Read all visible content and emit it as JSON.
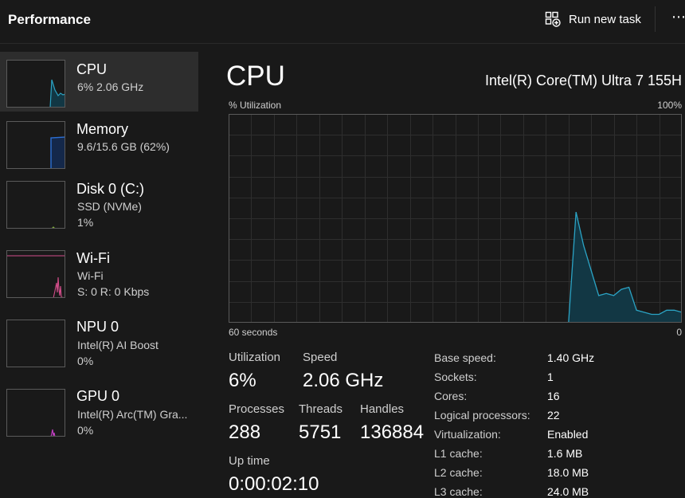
{
  "header": {
    "title": "Performance",
    "run_new_task": "Run new task",
    "more": "⋯"
  },
  "sidebar": {
    "items": [
      {
        "name": "CPU",
        "line1": "6%  2.06 GHz",
        "line2": ""
      },
      {
        "name": "Memory",
        "line1": "9.6/15.6 GB (62%)",
        "line2": ""
      },
      {
        "name": "Disk 0 (C:)",
        "line1": "SSD (NVMe)",
        "line2": "1%"
      },
      {
        "name": "Wi-Fi",
        "line1": "Wi-Fi",
        "line2": "S: 0  R: 0 Kbps"
      },
      {
        "name": "NPU 0",
        "line1": "Intel(R) AI Boost",
        "line2": "0%"
      },
      {
        "name": "GPU 0",
        "line1": "Intel(R) Arc(TM) Gra...",
        "line2": "0%"
      }
    ]
  },
  "main": {
    "title": "CPU",
    "model": "Intel(R) Core(TM) Ultra 7 155H",
    "graph": {
      "y_label": "% Utilization",
      "y_max_label": "100%",
      "x_left_label": "60 seconds",
      "x_right_label": "0"
    },
    "stats": {
      "utilization_label": "Utilization",
      "utilization": "6%",
      "speed_label": "Speed",
      "speed": "2.06 GHz",
      "processes_label": "Processes",
      "processes": "288",
      "threads_label": "Threads",
      "threads": "5751",
      "handles_label": "Handles",
      "handles": "136884",
      "uptime_label": "Up time",
      "uptime": "0:00:02:10"
    },
    "specs": [
      {
        "label": "Base speed:",
        "value": "1.40 GHz"
      },
      {
        "label": "Sockets:",
        "value": "1"
      },
      {
        "label": "Cores:",
        "value": "16"
      },
      {
        "label": "Logical processors:",
        "value": "22"
      },
      {
        "label": "Virtualization:",
        "value": "Enabled"
      },
      {
        "label": "L1 cache:",
        "value": "1.6 MB"
      },
      {
        "label": "L2 cache:",
        "value": "18.0 MB"
      },
      {
        "label": "L3 cache:",
        "value": "24.0 MB"
      }
    ]
  },
  "colors": {
    "cpu_line": "#2ba3c4",
    "cpu_fill": "#123744",
    "memory_line": "#2c6fd4",
    "wifi_line": "#d24d8a",
    "gpu_line": "#c43fc4",
    "disk_line": "#7fae3a"
  },
  "chart_data": {
    "type": "area",
    "x": [
      60,
      59,
      58,
      57,
      56,
      55,
      54,
      53,
      52,
      51,
      50,
      49,
      48,
      47,
      46,
      45,
      44,
      43,
      42,
      41,
      40,
      39,
      38,
      37,
      36,
      35,
      34,
      33,
      32,
      31,
      30,
      29,
      28,
      27,
      26,
      25,
      24,
      23,
      22,
      21,
      20,
      19,
      18,
      17,
      16,
      15,
      14,
      13,
      12,
      11,
      10,
      9,
      8,
      7,
      6,
      5,
      4,
      3,
      2,
      1,
      0
    ],
    "series": [
      {
        "values": [
          0,
          0,
          0,
          0,
          0,
          0,
          0,
          0,
          0,
          0,
          0,
          0,
          0,
          0,
          0,
          0,
          0,
          0,
          0,
          0,
          0,
          0,
          0,
          0,
          0,
          0,
          0,
          0,
          0,
          0,
          0,
          0,
          0,
          0,
          0,
          0,
          0,
          0,
          0,
          0,
          0,
          0,
          0,
          0,
          0,
          0,
          53,
          37,
          25,
          13,
          14,
          13,
          16,
          17,
          6,
          5,
          4,
          4,
          6,
          6,
          5
        ]
      }
    ],
    "xlabel": "60 seconds",
    "ylabel": "% Utilization",
    "ylim": [
      0,
      100
    ],
    "grid": true
  }
}
